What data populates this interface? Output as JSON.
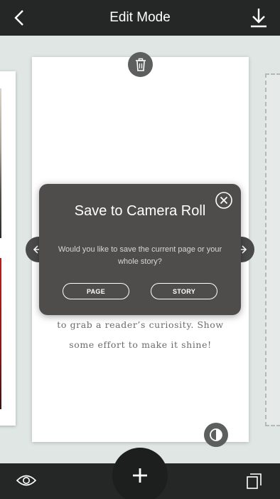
{
  "header": {
    "title": "Edit Mode",
    "back_icon": "chevron-left-icon",
    "download_icon": "download-icon"
  },
  "page": {
    "body_lines": [
      "to grab a reader’s curiosity. Show",
      "some effort to make it shine!"
    ]
  },
  "dialog": {
    "title": "Save to Camera Roll",
    "message": "Would you like to save the current page or your whole story?",
    "options": [
      "PAGE",
      "STORY"
    ],
    "close_icon": "close-circle-icon"
  },
  "toolbar": {
    "preview_icon": "eye-icon",
    "add_icon": "plus-icon",
    "pages_icon": "pages-icon"
  },
  "colors": {
    "bar": "#252626",
    "dialog": "#4e4d4c",
    "canvas": "#dfe6e4"
  }
}
